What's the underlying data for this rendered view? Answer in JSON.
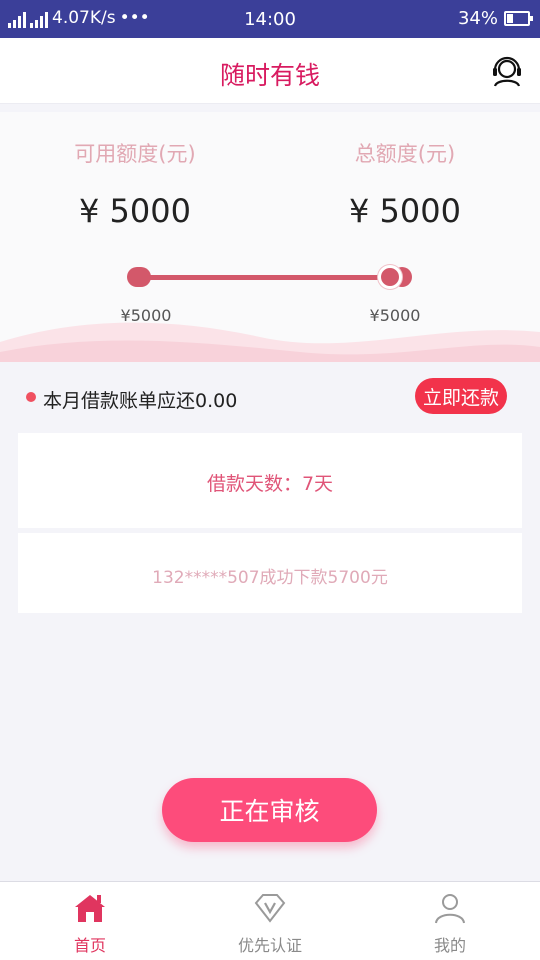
{
  "status_bar": {
    "network_label": "4G",
    "speed": "4.07K/s",
    "more": "•••",
    "time": "14:00",
    "battery": "34%",
    "battery_level": 0.34
  },
  "header": {
    "title": "随时有钱",
    "right_icon": "customer-service-icon"
  },
  "quota": {
    "available_label": "可用额度(元)",
    "available_value": "¥ 5000",
    "total_label": "总额度(元)",
    "total_value": "¥ 5000",
    "slider_min_label": "¥5000",
    "slider_max_label": "¥5000"
  },
  "bill": {
    "text": "本月借款账单应还0.00",
    "repay_button": "立即还款"
  },
  "cards": {
    "loan_days": "借款天数：7天",
    "notice": "132*****507成功下款5700元"
  },
  "main_button": "正在审核",
  "tabs": [
    {
      "label": "首页",
      "icon": "home-icon",
      "active": true
    },
    {
      "label": "优先认证",
      "icon": "diamond-v-icon",
      "active": false
    },
    {
      "label": "我的",
      "icon": "user-icon",
      "active": false
    }
  ],
  "colors": {
    "status_bar": "#3b3f99",
    "brand": "#d81b60",
    "accent": "#fd4c7b",
    "repay": "#f2334b"
  }
}
